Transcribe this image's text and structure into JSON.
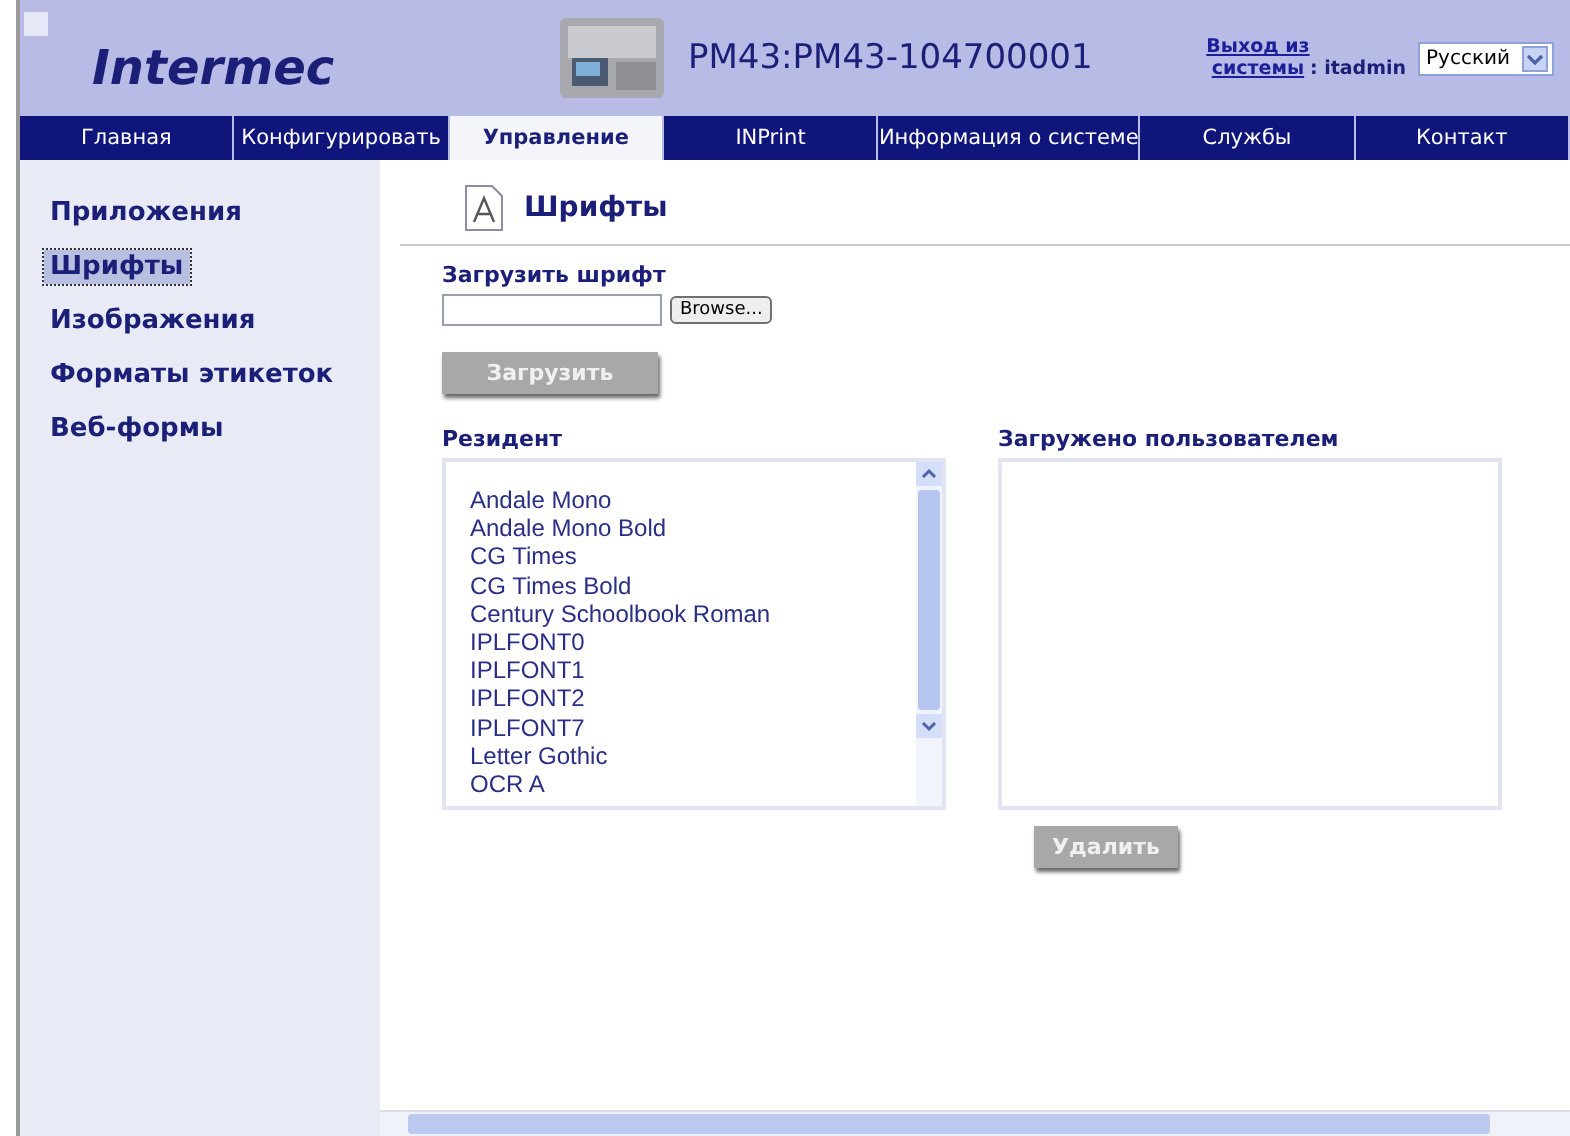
{
  "header": {
    "logo": "Intermec",
    "device_title": "PM43:PM43-104700001",
    "logout_link": "Выход из системы",
    "user_label": ": itadmin",
    "language": "Русский"
  },
  "tabs": [
    {
      "label": "Главная",
      "selected": false
    },
    {
      "label": "Конфигурировать",
      "selected": false
    },
    {
      "label": "Управление",
      "selected": true
    },
    {
      "label": "INPrint",
      "selected": false
    },
    {
      "label": "Информация о системе",
      "selected": false
    },
    {
      "label": "Службы",
      "selected": false
    },
    {
      "label": "Контакт",
      "selected": false
    }
  ],
  "sidebar": {
    "items": [
      {
        "label": "Приложения",
        "selected": false
      },
      {
        "label": "Шрифты",
        "selected": true
      },
      {
        "label": "Изображения",
        "selected": false
      },
      {
        "label": "Форматы этикеток",
        "selected": false
      },
      {
        "label": "Веб-формы",
        "selected": false
      }
    ]
  },
  "page_title": "Шрифты",
  "upload": {
    "label": "Загрузить шрифт",
    "browse_button": "Browse...",
    "submit_button": "Загрузить"
  },
  "resident": {
    "title": "Резидент",
    "fonts": [
      "Andale Mono",
      "Andale Mono Bold",
      "CG Times",
      "CG Times Bold",
      "Century Schoolbook Roman",
      "IPLFONT0",
      "IPLFONT1",
      "IPLFONT2",
      "IPLFONT7",
      "Letter Gothic",
      "OCR A"
    ]
  },
  "user_loaded": {
    "title": "Загружено пользователем",
    "delete_button": "Удалить"
  }
}
